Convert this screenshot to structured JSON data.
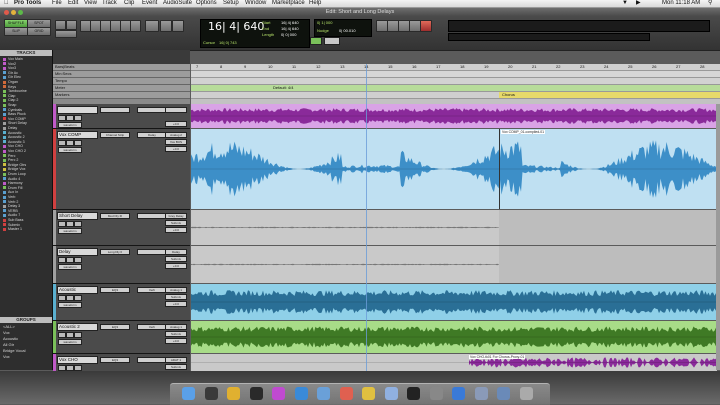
{
  "menubar": {
    "apple": "",
    "app_name": "Pro Tools",
    "items": [
      "File",
      "Edit",
      "View",
      "Track",
      "Clip",
      "Event",
      "AudioSuite",
      "Options",
      "Setup",
      "Window",
      "Marketplace",
      "Help"
    ],
    "clock": "Mon 11:18 AM"
  },
  "window": {
    "title": "Edit: Short and Long Delays"
  },
  "toolbar": {
    "main_counter": "16| 4| 640",
    "start": "Start",
    "end": "End",
    "length": "Length",
    "start_val": "16| 4| 640",
    "end_val": "16| 4| 640",
    "length_val": "0| 0| 000",
    "cursor_label": "Cursor",
    "cursor_val": "16| 0| 743",
    "nudge_label": "Nudge",
    "nudge_val": "0| 00.010",
    "grid_val": "0| 1| 000",
    "mode_shuffle": "SHUFFLE",
    "mode_spot": "SPOT",
    "mode_slip": "SLIP",
    "mode_grid": "GRID"
  },
  "left_panel": {
    "tracks_header": "TRACKS",
    "tracks": [
      {
        "name": "Vox Main",
        "color": "#c05ac8"
      },
      {
        "name": "Vox2",
        "color": "#c05ac8"
      },
      {
        "name": "Vox3",
        "color": "#c05ac8"
      },
      {
        "name": "Gtr Ac",
        "color": "#5aa0d0"
      },
      {
        "name": "Gtr Elec",
        "color": "#5aa0d0"
      },
      {
        "name": "Organ",
        "color": "#d06a3a"
      },
      {
        "name": "Keys",
        "color": "#d06a3a"
      },
      {
        "name": "Tambourine",
        "color": "#7ac05a"
      },
      {
        "name": "Clap",
        "color": "#7ac05a"
      },
      {
        "name": "Clap 2",
        "color": "#7ac05a"
      },
      {
        "name": "Snap",
        "color": "#7ac05a"
      },
      {
        "name": "Cymbals",
        "color": "#5aa0d0"
      },
      {
        "name": "Bass Pluck",
        "color": "#5aa0d0"
      },
      {
        "name": "Vox COMP",
        "color": "#d04040"
      },
      {
        "name": "Short Delay",
        "color": "#a0a0a0"
      },
      {
        "name": "Delay",
        "color": "#a0a0a0"
      },
      {
        "name": "Acoustic",
        "color": "#5ab0d0"
      },
      {
        "name": "Acoustic 2",
        "color": "#5ab0d0"
      },
      {
        "name": "Acoustic 3",
        "color": "#5ab0d0"
      },
      {
        "name": "Vox CHO",
        "color": "#c05ac8"
      },
      {
        "name": "Vox CHO 2",
        "color": "#c05ac8"
      },
      {
        "name": "Perc",
        "color": "#7ac05a"
      },
      {
        "name": "Perc 2",
        "color": "#7ac05a"
      },
      {
        "name": "Bridge Gtrs",
        "color": "#d0c040"
      },
      {
        "name": "Bridge Vox",
        "color": "#d0c040"
      },
      {
        "name": "Drum Loop",
        "color": "#7ac05a"
      },
      {
        "name": "Audio 4",
        "color": "#5aa0d0"
      },
      {
        "name": "Harmony",
        "color": "#c05ac8"
      },
      {
        "name": "Drum Fill",
        "color": "#7ac05a"
      },
      {
        "name": "Aux In",
        "color": "#5aa0d0"
      },
      {
        "name": "Verb",
        "color": "#5aa0d0"
      },
      {
        "name": "Verb 2",
        "color": "#5aa0d0"
      },
      {
        "name": "Delay 3",
        "color": "#a0a0a0"
      },
      {
        "name": "VERB",
        "color": "#5aa0d0"
      },
      {
        "name": "Audio 7",
        "color": "#5aa0d0"
      },
      {
        "name": "Sub Bass",
        "color": "#d04040"
      },
      {
        "name": "Submix",
        "color": "#d04040"
      },
      {
        "name": "Master 1",
        "color": "#d04040"
      }
    ],
    "groups_header": "GROUPS",
    "groups": [
      "<ALL>",
      "Vox",
      "Acoustic",
      "All Gtr",
      "Bridge Vocal",
      "Vox"
    ]
  },
  "rulers": [
    {
      "label": "Bars|Beats"
    },
    {
      "label": "Min:Secs"
    },
    {
      "label": "Tempo"
    },
    {
      "label": "Meter"
    },
    {
      "label": "Markers"
    }
  ],
  "ruler_numbers": [
    "7",
    "8",
    "9",
    "10",
    "11",
    "12",
    "13",
    "14",
    "15",
    "16",
    "17",
    "18",
    "19",
    "20",
    "21",
    "22",
    "23",
    "24",
    "25",
    "26",
    "27",
    "28"
  ],
  "meter_text": "Default: 4/4",
  "marker_text": "Chorus",
  "tracks": [
    {
      "name": "",
      "insert1": "",
      "send1": "",
      "io": "",
      "color": "#c05ac8",
      "lane_color": "#d9a3e6",
      "wave_color": "#8a2a9a",
      "view": "waveform"
    },
    {
      "name": "Vox COMP",
      "insert1": "Channel Strip",
      "send1": "Delay",
      "io": "Analog 2",
      "io2": "Vox BUS",
      "insert2": "",
      "send2": "Grey Delay",
      "color": "#d04040",
      "lane_color": "#bfe0f2",
      "wave_color": "#3d8fc8",
      "view": "waveform",
      "clip": "Vox COMP_01-compiled-01"
    },
    {
      "name": "Short Delay",
      "insert1": "Mod Dly III",
      "send1": "",
      "io": "Grey Delay",
      "io2": "Submix",
      "color": "#a0a0a0",
      "lane_color": "#c9c9c9",
      "wave_color": "#888888",
      "view": "waveform"
    },
    {
      "name": "Delay",
      "insert1": "Long Dly II",
      "send1": "",
      "io": "Delay",
      "io2": "Submix",
      "color": "#a0a0a0",
      "lane_color": "#c9c9c9",
      "wave_color": "#888888",
      "view": "waveform"
    },
    {
      "name": "Acoustic",
      "insert1": "EQ3",
      "send1": "Verb",
      "io": "Analog 1",
      "io2": "Submix",
      "color": "#5ab0d0",
      "lane_color": "#8fd0e8",
      "wave_color": "#2a6f96",
      "view": "waveform"
    },
    {
      "name": "Acoustic 2",
      "insert1": "EQ3",
      "send1": "Verb",
      "io": "Analog 1",
      "io2": "Submix",
      "color": "#7ac05a",
      "lane_color": "#a8dc88",
      "wave_color": "#3f7a25",
      "view": "waveform"
    },
    {
      "name": "Vox CHO",
      "insert1": "EQ3",
      "send1": "",
      "io": "ADAT 1",
      "io2": "Submix",
      "color": "#c05ac8",
      "lane_color": "#c9c9c9",
      "wave_color": "#8a2a9a",
      "view": "waveform",
      "clip": "Vox CHO-tk01 For Chorus-Proxy-01"
    }
  ],
  "track_controls": {
    "waveform": "waveform",
    "dyn": "dyn",
    "read": "read",
    "vol": "vol",
    "pan": "pan",
    "rec": "rec",
    "vol_val": "+0.0",
    "pan_val": "100"
  },
  "dock_apps": [
    "Finder",
    "Dashboard",
    "Chrome",
    "Pro Tools",
    "iTunes",
    "Safari",
    "Mail",
    "Calendar",
    "Photos",
    "Preview",
    "Terminal",
    "System Preferences",
    "App Store",
    "Documents",
    "Downloads",
    "Trash"
  ]
}
